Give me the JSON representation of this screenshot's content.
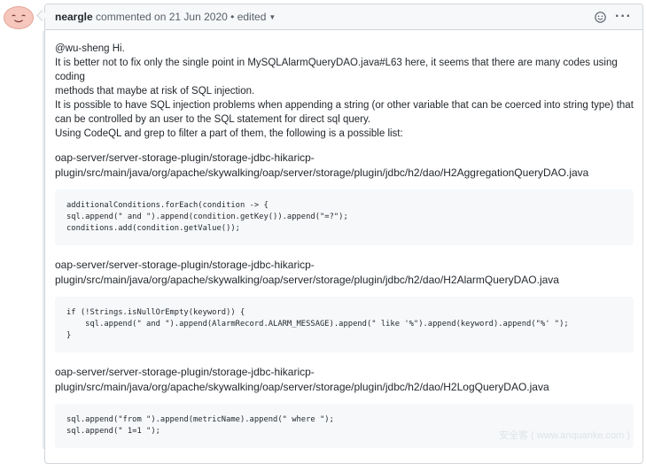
{
  "comment": {
    "author": "neargle",
    "meta": "commented on 21 Jun 2020",
    "separator": "•",
    "edited": "edited",
    "icons": [
      "emoji-smiley-icon",
      "kebab-horizontal-icon"
    ]
  },
  "body": {
    "mention": "@wu-sheng Hi.",
    "lines": [
      "It is better not to fix only the single point in MySQLAlarmQueryDAO.java#L63 here, it seems that there are many codes using coding",
      "methods that maybe at risk of SQL injection.",
      "It is possible to have SQL injection problems when appending a string (or other variable that can be coerced into string type) that",
      "can be controlled by an user to the SQL statement for direct sql query.",
      "Using CodeQL and grep to filter a part of them, the following is a possible list:"
    ],
    "files": [
      {
        "path_line1": "oap-server/server-storage-plugin/storage-jdbc-hikaricp-",
        "path_line2": "plugin/src/main/java/org/apache/skywalking/oap/server/storage/plugin/jdbc/h2/dao/H2AggregationQueryDAO.java",
        "code": "additionalConditions.forEach(condition -> {\nsql.append(\" and \").append(condition.getKey()).append(\"=?\");\nconditions.add(condition.getValue());"
      },
      {
        "path_line1": "oap-server/server-storage-plugin/storage-jdbc-hikaricp-",
        "path_line2": "plugin/src/main/java/org/apache/skywalking/oap/server/storage/plugin/jdbc/h2/dao/H2AlarmQueryDAO.java",
        "code": "if (!Strings.isNullOrEmpty(keyword)) {\n    sql.append(\" and \").append(AlarmRecord.ALARM_MESSAGE).append(\" like '%\").append(keyword).append(\"%' \");\n}"
      },
      {
        "path_line1": "oap-server/server-storage-plugin/storage-jdbc-hikaricp-",
        "path_line2": "plugin/src/main/java/org/apache/skywalking/oap/server/storage/plugin/jdbc/h2/dao/H2LogQueryDAO.java",
        "code": "sql.append(\"from \").append(metricName).append(\" where \");\nsql.append(\" 1=1 \");"
      }
    ]
  },
  "watermark": "安全客 ( www.anquanke.com )"
}
